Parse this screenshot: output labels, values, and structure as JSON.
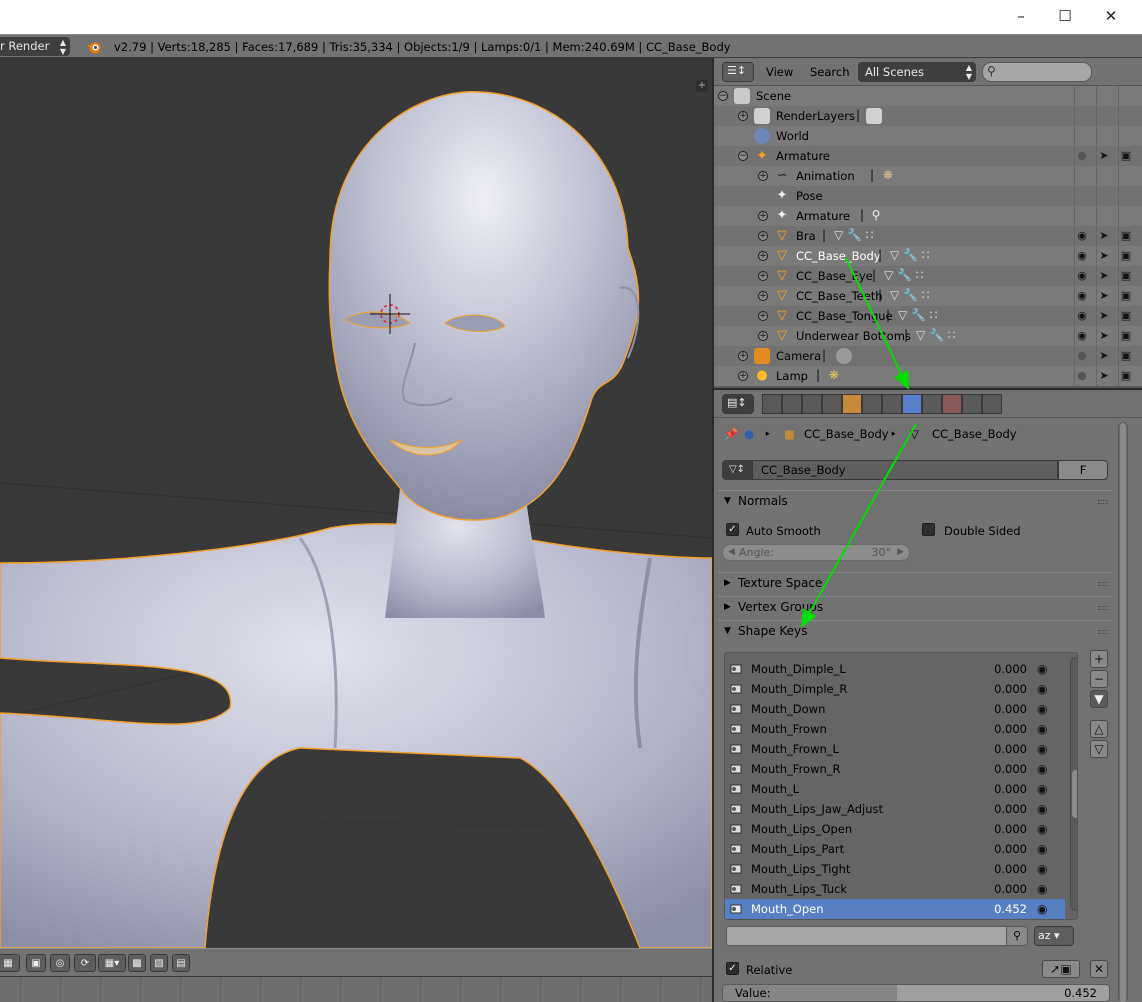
{
  "window": {
    "minimize_icon": "minimize-icon",
    "maximize_icon": "maximize-icon",
    "close_icon": "close-icon"
  },
  "info_header": {
    "render_engine": "r Render",
    "stats": "v2.79 | Verts:18,285 | Faces:17,689 | Tris:35,334 | Objects:1/9 | Lamps:0/1 | Mem:240.69M | CC_Base_Body"
  },
  "outliner": {
    "menu_view": "View",
    "menu_search": "Search",
    "display_mode": "All Scenes",
    "search_placeholder": "",
    "rows": [
      {
        "label": "Scene",
        "extra": ""
      },
      {
        "label": "RenderLayers",
        "extra": "|"
      },
      {
        "label": "World",
        "extra": ""
      },
      {
        "label": "Armature",
        "extra": ""
      },
      {
        "label": "Animation",
        "extra": "|"
      },
      {
        "label": "Pose",
        "extra": ""
      },
      {
        "label": "Armature",
        "extra": "|"
      },
      {
        "label": "Bra",
        "extra": "|"
      },
      {
        "label": "CC_Base_Body",
        "extra": "|"
      },
      {
        "label": "CC_Base_Eye",
        "extra": "|"
      },
      {
        "label": "CC_Base_Teeth",
        "extra": "|"
      },
      {
        "label": "CC_Base_Tongue",
        "extra": "|"
      },
      {
        "label": "Underwear Bottoms",
        "extra": "|"
      },
      {
        "label": "Camera",
        "extra": "|"
      },
      {
        "label": "Lamp",
        "extra": "|"
      }
    ]
  },
  "properties": {
    "breadcrumb": {
      "object": "CC_Base_Body",
      "mesh": "CC_Base_Body"
    },
    "mesh_datablock": {
      "name": "CC_Base_Body",
      "fake_user": "F"
    },
    "normals": {
      "title": "Normals",
      "auto_smooth_label": "Auto Smooth",
      "auto_smooth_checked": true,
      "double_sided_label": "Double Sided",
      "double_sided_checked": false,
      "angle_label": "Angle:",
      "angle_value": "30°"
    },
    "texture_space_title": "Texture Space",
    "vertex_groups_title": "Vertex Groups",
    "shape_keys": {
      "title": "Shape Keys",
      "items": [
        {
          "name": "Mouth_Dimple_L",
          "value": "0.000"
        },
        {
          "name": "Mouth_Dimple_R",
          "value": "0.000"
        },
        {
          "name": "Mouth_Down",
          "value": "0.000"
        },
        {
          "name": "Mouth_Frown",
          "value": "0.000"
        },
        {
          "name": "Mouth_Frown_L",
          "value": "0.000"
        },
        {
          "name": "Mouth_Frown_R",
          "value": "0.000"
        },
        {
          "name": "Mouth_L",
          "value": "0.000"
        },
        {
          "name": "Mouth_Lips_Jaw_Adjust",
          "value": "0.000"
        },
        {
          "name": "Mouth_Lips_Open",
          "value": "0.000"
        },
        {
          "name": "Mouth_Lips_Part",
          "value": "0.000"
        },
        {
          "name": "Mouth_Lips_Tight",
          "value": "0.000"
        },
        {
          "name": "Mouth_Lips_Tuck",
          "value": "0.000"
        },
        {
          "name": "Mouth_Open",
          "value": "0.452",
          "selected": true
        }
      ],
      "filter_placeholder": "",
      "relative_label": "Relative",
      "relative_checked": true,
      "value_label": "Value:",
      "value": "0.452",
      "value_fraction": 0.452
    }
  },
  "colors": {
    "selection_blue": "#5680c2",
    "annotation_arrow": "#00e000",
    "object_outline": "#f0a030"
  }
}
